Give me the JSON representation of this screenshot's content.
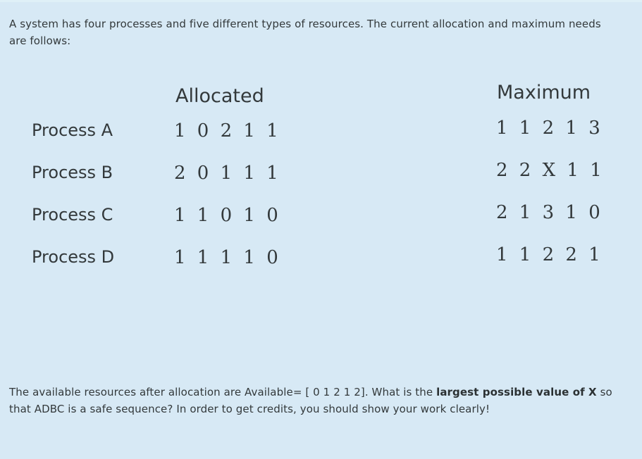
{
  "colors": {
    "background": "#d7e9f5",
    "top_strip": "#dff0f7",
    "text": "#33393b"
  },
  "intro": {
    "text": "A system has four processes and five different types of resources. The current allocation and maximum needs are follows:"
  },
  "table": {
    "headers": {
      "allocated": "Allocated",
      "maximum": "Maximum"
    },
    "rows": [
      {
        "process": "Process A",
        "allocated": "1 0 2 1 1",
        "maximum": "1 1 2 1 3"
      },
      {
        "process": "Process B",
        "allocated": "2 0 1 1 1",
        "maximum": "2 2 X 1 1"
      },
      {
        "process": "Process C",
        "allocated": "1 1 0 1 0",
        "maximum": "2 1 3 1 0"
      },
      {
        "process": "Process D",
        "allocated": "1 1 1 1 0",
        "maximum": "1 1 2 2 1"
      }
    ]
  },
  "question": {
    "part1": "The available resources after allocation are Available= [ 0 1 2 1 2]. What is the ",
    "bold1": "largest possible value of X",
    "part2": " so that ADBC is a safe sequence? In order to get credits, you should show your work clearly!"
  }
}
